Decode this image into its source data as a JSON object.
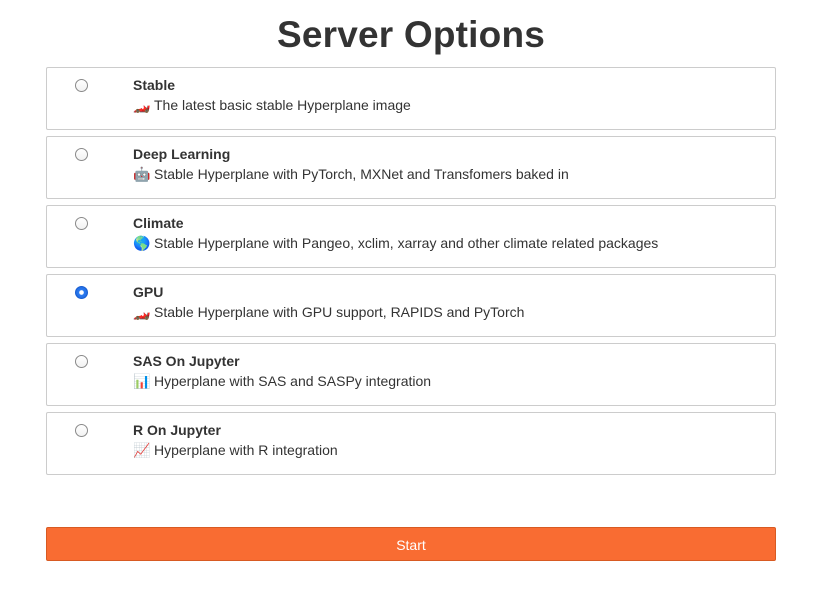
{
  "page": {
    "title": "Server Options"
  },
  "options": [
    {
      "title": "Stable",
      "icon": "🏎️",
      "icon_name": "racetrack-icon",
      "description": "The latest basic stable Hyperplane image",
      "selected": false
    },
    {
      "title": "Deep Learning",
      "icon": "🤖",
      "icon_name": "robot-icon",
      "description": "Stable Hyperplane with PyTorch, MXNet and Transfomers baked in",
      "selected": false
    },
    {
      "title": "Climate",
      "icon": "🌎",
      "icon_name": "globe-icon",
      "description": "Stable Hyperplane with Pangeo, xclim, xarray and other climate related packages",
      "selected": false
    },
    {
      "title": "GPU",
      "icon": "🏎️",
      "icon_name": "race-car-icon",
      "description": "Stable Hyperplane with GPU support, RAPIDS and PyTorch",
      "selected": true
    },
    {
      "title": "SAS On Jupyter",
      "icon": "📊",
      "icon_name": "bar-chart-icon",
      "description": "Hyperplane with SAS and SASPy integration",
      "selected": false
    },
    {
      "title": "R On Jupyter",
      "icon": "📈",
      "icon_name": "line-chart-icon",
      "description": "Hyperplane with R integration",
      "selected": false
    }
  ],
  "start_button": {
    "label": "Start"
  },
  "colors": {
    "accent": "#f96c32",
    "selected_radio": "#1c63dc",
    "border": "#cccccc",
    "text": "#333333"
  }
}
